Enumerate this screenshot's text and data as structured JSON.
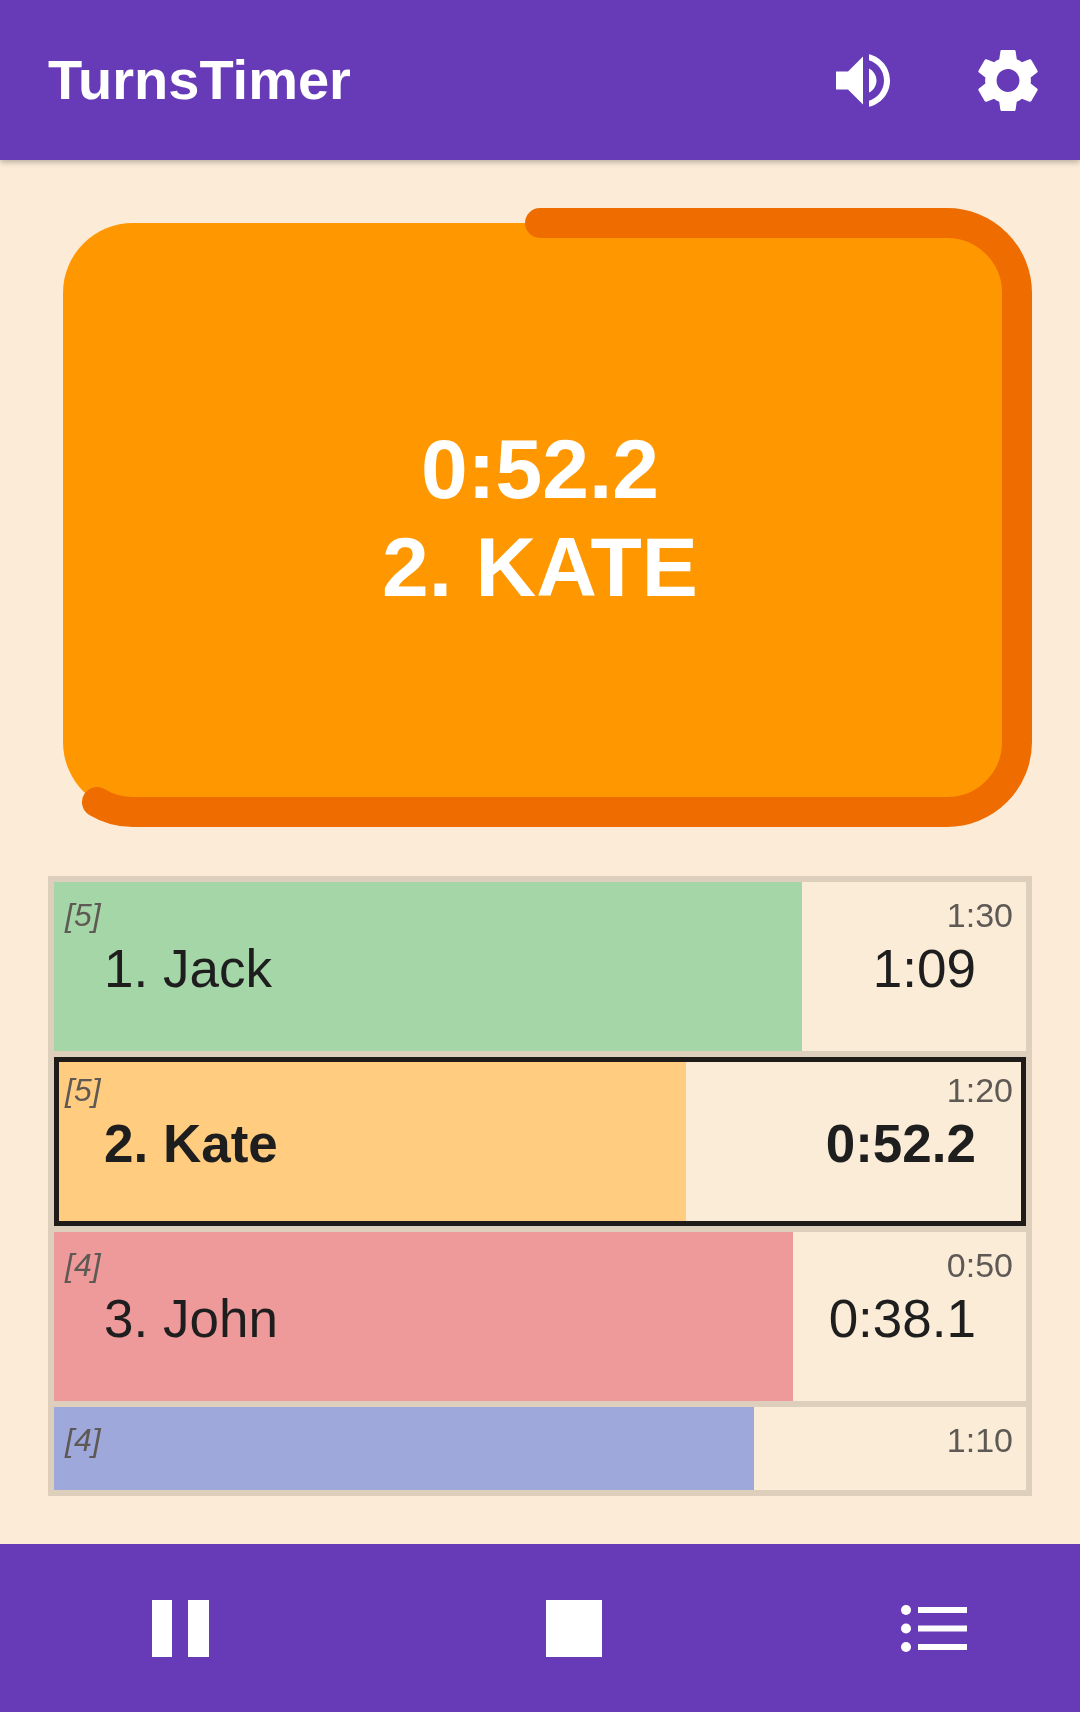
{
  "app_bar": {
    "title": "TurnsTimer"
  },
  "timer": {
    "time": "0:52.2",
    "player": "2. KATE"
  },
  "players": [
    {
      "tag": "[5]",
      "name": "1. Jack",
      "limit": "1:30",
      "time": "1:09",
      "level": 0.77,
      "color": "#a5d6a7",
      "selected": false
    },
    {
      "tag": "[5]",
      "name": "2. Kate",
      "limit": "1:20",
      "time": "0:52.2",
      "level": 0.65,
      "color": "#ffcc80",
      "selected": true
    },
    {
      "tag": "[4]",
      "name": "3. John",
      "limit": "0:50",
      "time": "0:38.1",
      "level": 0.76,
      "color": "#ef9a9a",
      "selected": false
    },
    {
      "tag": "[4]",
      "limit": "1:10",
      "level": 0.72,
      "color": "#9fa8da",
      "selected": false
    }
  ]
}
